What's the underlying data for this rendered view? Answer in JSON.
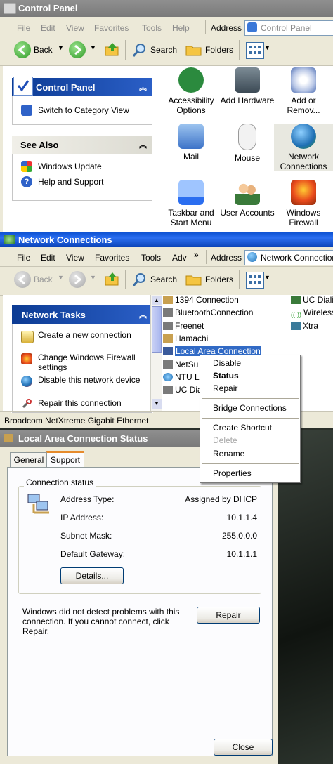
{
  "control_panel": {
    "title": "Control Panel",
    "menu": [
      "File",
      "Edit",
      "View",
      "Favorites",
      "Tools",
      "Help"
    ],
    "toolbar": {
      "back": "Back",
      "search": "Search",
      "folders": "Folders"
    },
    "address_label": "Address",
    "address_value": "Control Panel",
    "taskpane_title": "Control Panel",
    "switch_view": "Switch to Category View",
    "see_also_title": "See Also",
    "see_also": [
      "Windows Update",
      "Help and Support"
    ],
    "items": [
      {
        "label": "Accessibility Options"
      },
      {
        "label": "Add Hardware"
      },
      {
        "label": "Add or Remov..."
      },
      {
        "label": "Mail"
      },
      {
        "label": "Mouse"
      },
      {
        "label": "Network Connections"
      },
      {
        "label": "Taskbar and Start Menu"
      },
      {
        "label": "User Accounts"
      },
      {
        "label": "Windows Firewall"
      }
    ]
  },
  "network_connections": {
    "title": "Network Connections",
    "menu": [
      "File",
      "Edit",
      "View",
      "Favorites",
      "Tools",
      "Adv",
      "»"
    ],
    "toolbar": {
      "back": "Back",
      "search": "Search",
      "folders": "Folders"
    },
    "address_label": "Address",
    "address_value": "Network Connection",
    "tasks_title": "Network Tasks",
    "tasks": [
      "Create a new connection",
      "Change Windows Firewall settings",
      "Disable this network device",
      "Repair this connection"
    ],
    "connections_left": [
      "1394 Connection",
      "BluetoothConnection",
      "Freenet",
      "Hamachi",
      "Local Area Connection",
      "NetSu",
      "NTU Li",
      "UC Dia"
    ],
    "connections_right": [
      "UC Dialin",
      "Wireless",
      "Xtra"
    ],
    "statusbar": "Broadcom NetXtreme Gigabit Ethernet"
  },
  "context_menu": {
    "items": [
      "Disable",
      "Status",
      "Repair",
      "Bridge Connections",
      "Create Shortcut",
      "Delete",
      "Rename",
      "Properties"
    ]
  },
  "status_dialog": {
    "title": "Local Area Connection Status",
    "tabs": [
      "General",
      "Support"
    ],
    "group_label": "Connection status",
    "rows": [
      {
        "label": "Address Type:",
        "value": "Assigned by DHCP"
      },
      {
        "label": "IP Address:",
        "value": "10.1.1.4"
      },
      {
        "label": "Subnet Mask:",
        "value": "255.0.0.0"
      },
      {
        "label": "Default Gateway:",
        "value": "10.1.1.1"
      }
    ],
    "details_button": "Details...",
    "message": "Windows did not detect problems with this connection. If you cannot connect, click Repair.",
    "repair_button": "Repair",
    "close_button": "Close"
  },
  "colors": {
    "xp_blue": "#0a4fcf",
    "task_blue": "#0c3b93",
    "inactive_title": "#7a7a7a",
    "face": "#ece9d8"
  }
}
